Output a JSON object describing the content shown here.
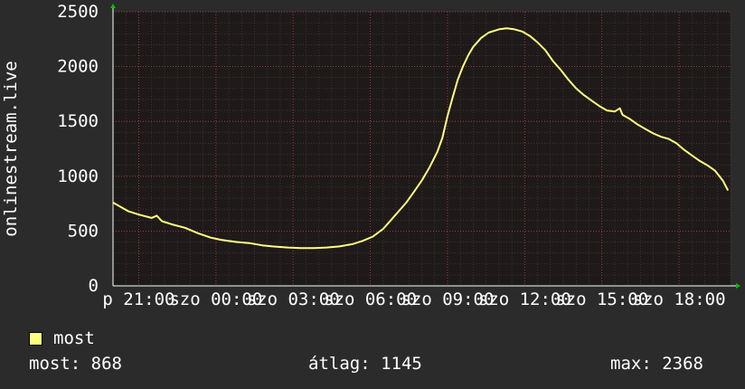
{
  "chart_data": {
    "type": "line",
    "ylabel": "onlinestream.live",
    "ylim": [
      0,
      2500
    ],
    "yticks": [
      0,
      500,
      1000,
      1500,
      2000,
      2500
    ],
    "xlim": [
      -4.0,
      20.0
    ],
    "xticks": [
      {
        "hour": 21,
        "label": "p 21:00"
      },
      {
        "hour": 24,
        "label": "szo 00:00"
      },
      {
        "hour": 27,
        "label": "szo 03:00"
      },
      {
        "hour": 30,
        "label": "szo 06:00"
      },
      {
        "hour": 33,
        "label": "szo 09:00"
      },
      {
        "hour": 36,
        "label": "szo 12:00"
      },
      {
        "hour": 39,
        "label": "szo 15:00"
      },
      {
        "hour": 42,
        "label": "szo 18:00"
      }
    ],
    "x_range_hours": [
      20.0,
      44.0
    ],
    "series": [
      {
        "name": "most",
        "color": "#ffff80",
        "points": [
          [
            20.0,
            760
          ],
          [
            20.3,
            720
          ],
          [
            20.6,
            680
          ],
          [
            21.0,
            650
          ],
          [
            21.5,
            620
          ],
          [
            21.7,
            640
          ],
          [
            21.9,
            590
          ],
          [
            22.3,
            560
          ],
          [
            22.8,
            530
          ],
          [
            23.3,
            480
          ],
          [
            23.8,
            440
          ],
          [
            24.2,
            420
          ],
          [
            24.8,
            400
          ],
          [
            25.3,
            390
          ],
          [
            25.8,
            370
          ],
          [
            26.2,
            360
          ],
          [
            26.8,
            350
          ],
          [
            27.3,
            345
          ],
          [
            27.8,
            345
          ],
          [
            28.3,
            350
          ],
          [
            28.8,
            360
          ],
          [
            29.3,
            380
          ],
          [
            29.7,
            410
          ],
          [
            30.1,
            450
          ],
          [
            30.5,
            520
          ],
          [
            30.8,
            600
          ],
          [
            31.1,
            680
          ],
          [
            31.4,
            760
          ],
          [
            31.7,
            860
          ],
          [
            32.0,
            960
          ],
          [
            32.3,
            1080
          ],
          [
            32.6,
            1220
          ],
          [
            32.8,
            1350
          ],
          [
            33.0,
            1550
          ],
          [
            33.2,
            1720
          ],
          [
            33.4,
            1880
          ],
          [
            33.6,
            2000
          ],
          [
            33.8,
            2100
          ],
          [
            34.0,
            2180
          ],
          [
            34.3,
            2260
          ],
          [
            34.6,
            2310
          ],
          [
            35.0,
            2340
          ],
          [
            35.3,
            2350
          ],
          [
            35.6,
            2340
          ],
          [
            35.9,
            2320
          ],
          [
            36.2,
            2280
          ],
          [
            36.5,
            2220
          ],
          [
            36.8,
            2150
          ],
          [
            37.1,
            2050
          ],
          [
            37.4,
            1970
          ],
          [
            37.7,
            1880
          ],
          [
            38.0,
            1800
          ],
          [
            38.3,
            1740
          ],
          [
            38.6,
            1690
          ],
          [
            38.9,
            1640
          ],
          [
            39.2,
            1600
          ],
          [
            39.5,
            1590
          ],
          [
            39.7,
            1620
          ],
          [
            39.8,
            1560
          ],
          [
            40.1,
            1520
          ],
          [
            40.4,
            1470
          ],
          [
            40.7,
            1430
          ],
          [
            41.0,
            1390
          ],
          [
            41.3,
            1360
          ],
          [
            41.6,
            1340
          ],
          [
            41.9,
            1300
          ],
          [
            42.2,
            1240
          ],
          [
            42.5,
            1190
          ],
          [
            42.8,
            1140
          ],
          [
            43.1,
            1100
          ],
          [
            43.4,
            1050
          ],
          [
            43.7,
            960
          ],
          [
            43.9,
            870
          ]
        ]
      }
    ]
  },
  "legend": {
    "label": "most",
    "color": "#ffff80"
  },
  "stats": {
    "current": "most: 868",
    "average": "átlag: 1145",
    "max": "max: 2368"
  }
}
